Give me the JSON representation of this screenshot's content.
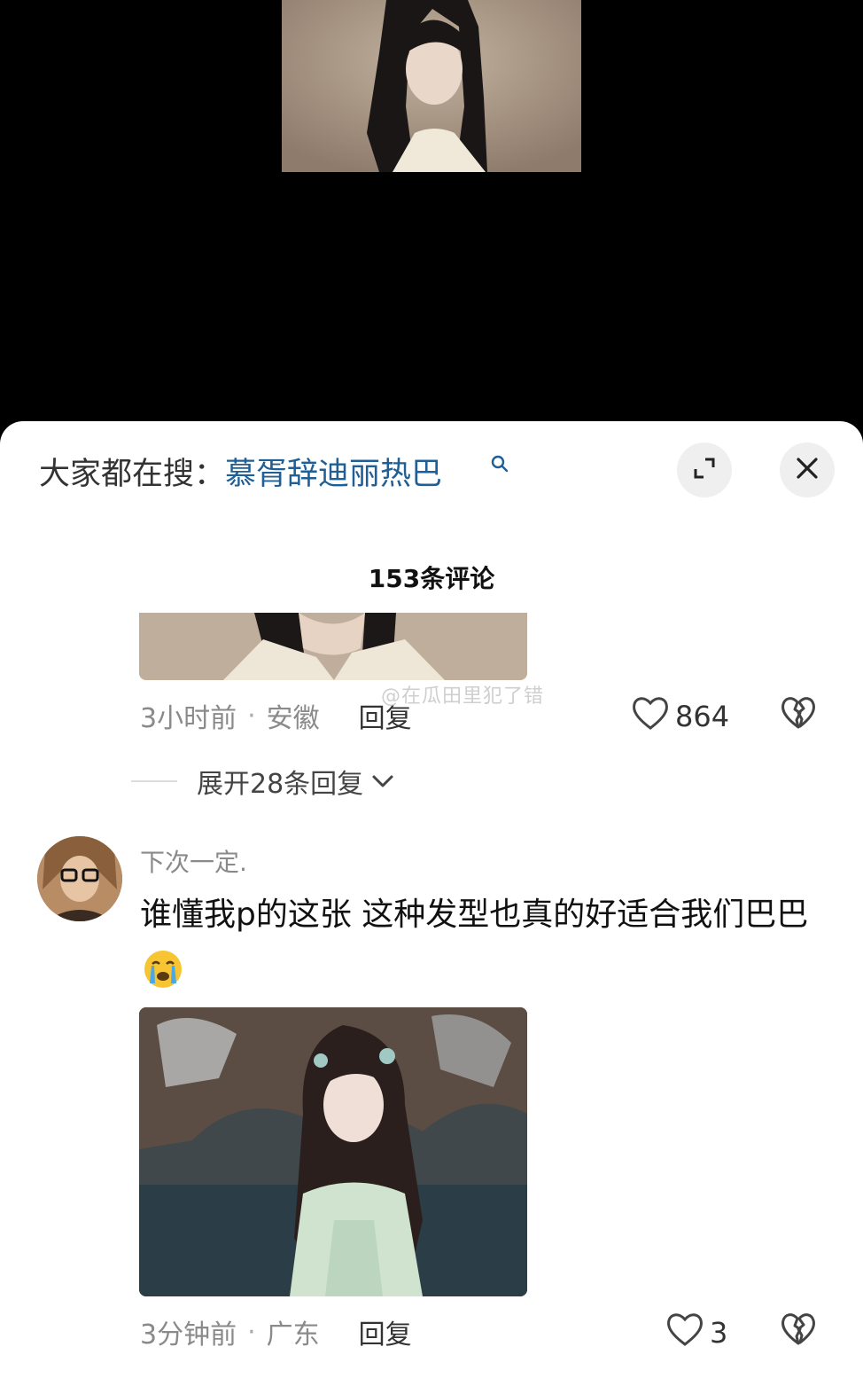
{
  "search": {
    "prefix": "大家都在搜：",
    "term": "慕胥辞迪丽热巴"
  },
  "header": {
    "comment_count": "153条评论"
  },
  "comments": [
    {
      "time": "3小时前",
      "location": "安徽",
      "reply_label": "回复",
      "likes": "864",
      "watermark": "@在瓜田里犯了错"
    },
    {
      "username": "下次一定.",
      "text": "谁懂我p的这张 这种发型也真的好适合我们巴巴",
      "time": "3分钟前",
      "location": "广东",
      "reply_label": "回复",
      "likes": "3"
    }
  ],
  "expand_replies": "展开28条回复",
  "icons": {
    "search": "search-icon",
    "expand": "expand-icon",
    "close": "close-icon",
    "like": "heart-icon",
    "dislike": "broken-heart-icon",
    "chevron": "chevron-down-icon",
    "emoji": "crying-emoji-icon"
  },
  "colors": {
    "search_term": "#1f5f96",
    "sheet_bg": "#ffffff",
    "video_bg": "#000000"
  }
}
